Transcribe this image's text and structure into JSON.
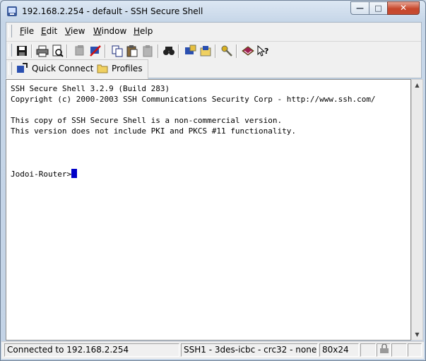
{
  "window": {
    "title": "192.168.2.254 - default - SSH Secure Shell",
    "min_glyph": "—",
    "max_glyph": "□",
    "close_glyph": "✕"
  },
  "menu": {
    "items": [
      {
        "acc": "F",
        "rest": "ile"
      },
      {
        "acc": "E",
        "rest": "dit"
      },
      {
        "acc": "V",
        "rest": "iew"
      },
      {
        "acc": "W",
        "rest": "indow"
      },
      {
        "acc": "H",
        "rest": "elp"
      }
    ]
  },
  "toolbar": {
    "icons": [
      "save-icon",
      "print-icon",
      "print-preview-icon",
      "disabled-copy-icon",
      "disconnect-icon",
      "copy-icon",
      "paste-icon",
      "paste-disabled-icon",
      "find-icon",
      "settings-icon",
      "new-file-transfer-icon",
      "key-icon",
      "help-book-icon",
      "context-help-icon"
    ]
  },
  "quickbar": {
    "quick_connect": "Quick Connect",
    "profiles": "Profiles"
  },
  "terminal": {
    "lines": [
      "SSH Secure Shell 3.2.9 (Build 283)",
      "Copyright (c) 2000-2003 SSH Communications Security Corp - http://www.ssh.com/",
      "",
      "This copy of SSH Secure Shell is a non-commercial version.",
      "This version does not include PKI and PKCS #11 functionality.",
      "",
      "",
      "",
      "Jodoi-Router>"
    ],
    "cursor_color": "#0000c8"
  },
  "status": {
    "connection": "Connected to 192.168.2.254",
    "cipher": "SSH1 - 3des-icbc - crc32 - none",
    "size": "80x24"
  },
  "colors": {
    "frame": "#c6d6e8",
    "close_button": "#c7472c"
  }
}
